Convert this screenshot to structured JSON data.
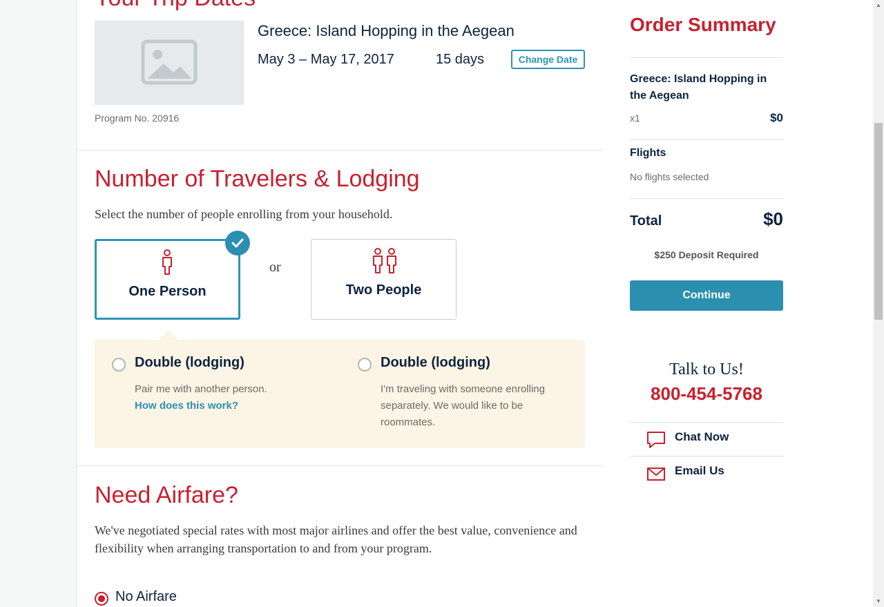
{
  "trip": {
    "section_title": "Your Trip Dates",
    "title": "Greece: Island Hopping in the Aegean",
    "dates": "May 3 – May 17, 2017",
    "duration": "15 days",
    "change_date_label": "Change Date",
    "program_no": "Program No. 20916",
    "image_icon": "image-placeholder-icon"
  },
  "travelers": {
    "section_title": "Number of Travelers & Lodging",
    "hint": "Select the number of people enrolling from your household.",
    "or_label": "or",
    "options": [
      {
        "label": "One Person",
        "icon": "single-person-icon",
        "selected": true
      },
      {
        "label": "Two People",
        "icon": "two-people-icon",
        "selected": false
      }
    ],
    "lodging": [
      {
        "title": "Double (lodging)",
        "description": "Pair me with another person.",
        "link": "How does this work?"
      },
      {
        "title": "Double (lodging)",
        "description": "I'm traveling with someone enrolling separately. We would like to be roommates."
      }
    ]
  },
  "airfare": {
    "section_title": "Need Airfare?",
    "description": "We've negotiated special rates with most major airlines and offer the best value, convenience and flexibility when arranging transportation to and from your program.",
    "options": [
      {
        "label": "No Airfare",
        "selected": true
      }
    ]
  },
  "order_summary": {
    "title": "Order Summary",
    "item_name": "Greece: Island Hopping in the Aegean",
    "item_qty": "x1",
    "item_price": "$0",
    "flights_label": "Flights",
    "flights_value": "No flights selected",
    "total_label": "Total",
    "total_value": "$0",
    "deposit": "$250 Deposit Required",
    "continue_label": "Continue"
  },
  "contact": {
    "title": "Talk to Us!",
    "phone": "800-454-5768",
    "chat_label": "Chat Now",
    "email_label": "Email Us"
  },
  "colors": {
    "brand_red": "#c8202f",
    "accent_blue": "#2b8fb0",
    "navy": "#0d2340",
    "lodging_bg": "#fcf4e4"
  }
}
